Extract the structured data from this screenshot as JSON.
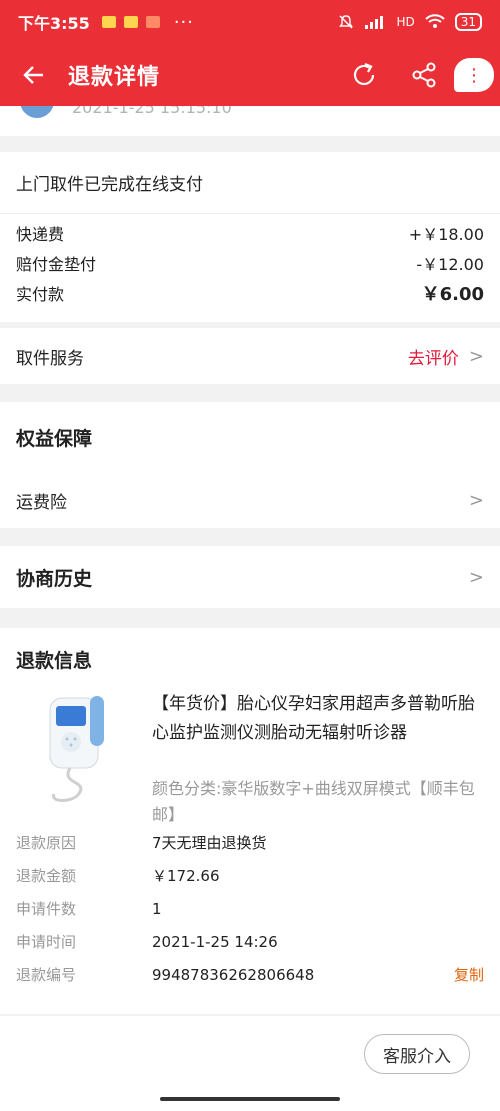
{
  "status_bar": {
    "time": "下午3:55",
    "dots": "···",
    "network": "HD",
    "battery": "31"
  },
  "app_bar": {
    "title": "退款详情"
  },
  "top_section": {
    "timestamp": "2021-1-25 15:15:10"
  },
  "payment": {
    "headline": "上门取件已完成在线支付",
    "lines": [
      {
        "label": "快递费",
        "value": "+￥18.00"
      },
      {
        "label": "赔付金垫付",
        "value": "-￥12.00"
      },
      {
        "label": "实付款",
        "value": "￥6.00"
      }
    ]
  },
  "service": {
    "label": "取件服务",
    "action": "去评价"
  },
  "rights": {
    "title": "权益保障",
    "item": "运费险"
  },
  "history": {
    "title": "协商历史"
  },
  "refund": {
    "title": "退款信息",
    "product_name": "【年货价】胎心仪孕妇家用超声多普勒听胎心监护监测仪测胎动无辐射听诊器",
    "product_sku": "颜色分类:豪华版数字+曲线双屏模式【顺丰包邮】",
    "fields": [
      {
        "label": "退款原因",
        "value": "7天无理由退换货"
      },
      {
        "label": "退款金额",
        "value": "￥172.66"
      },
      {
        "label": "申请件数",
        "value": "1"
      },
      {
        "label": "申请时间",
        "value": "2021-1-25 14:26"
      },
      {
        "label": "退款编号",
        "value": "99487836262806648"
      }
    ],
    "copy_label": "复制"
  },
  "footer": {
    "customer_service": "客服介入"
  },
  "colors": {
    "brand": "#ea2f36",
    "link": "#e4193b",
    "copy": "#e0650f"
  }
}
